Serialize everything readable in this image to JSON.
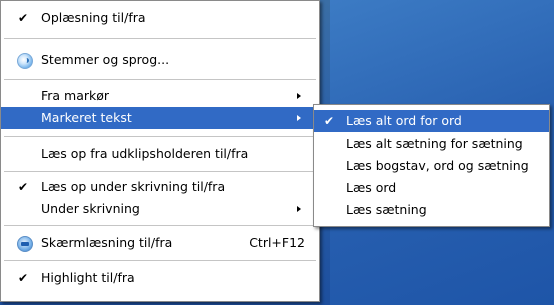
{
  "main_menu": {
    "reading_toggle": "Oplæsning til/fra",
    "voices_language": "Stemmer og sprog...",
    "from_cursor": "Fra markør",
    "selected_text": "Markeret tekst",
    "read_clipboard": "Læs op fra udklipsholderen til/fra",
    "read_while_typing": "Læs op under skrivning til/fra",
    "while_typing": "Under skrivning",
    "screen_reading": "Skærmlæsning til/fra",
    "screen_reading_shortcut": "Ctrl+F12",
    "highlight_toggle": "Highlight til/fra",
    "check_glyph": "✔"
  },
  "submenu": {
    "read_all_word_by_word": "Læs alt ord for ord",
    "read_all_sentence_by_sentence": "Læs alt sætning for sætning",
    "read_letter_word_sentence": "Læs bogstav, ord og sætning",
    "read_word": "Læs ord",
    "read_sentence": "Læs sætning"
  },
  "colors": {
    "highlight": "#316ac5",
    "desktop": "#2a5fa8"
  }
}
